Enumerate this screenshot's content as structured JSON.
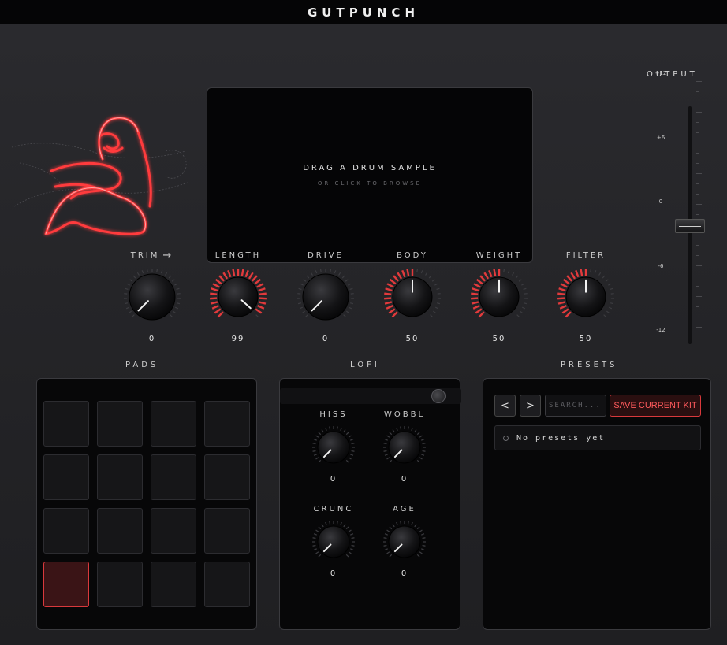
{
  "app": {
    "title": "GUTPUNCH"
  },
  "dropzone": {
    "main": "DRAG A DRUM SAMPLE",
    "sub": "OR CLICK TO BROWSE"
  },
  "knobs": [
    {
      "label": "TRIM",
      "value": "0",
      "arrow": "→",
      "ring": false,
      "level": 0
    },
    {
      "label": "LENGTH",
      "value": "99",
      "ring": true,
      "level": 0.99
    },
    {
      "label": "DRIVE",
      "value": "0",
      "ring": false,
      "level": 0
    },
    {
      "label": "BODY",
      "value": "50",
      "ring": true,
      "level": 0.5
    },
    {
      "label": "WEIGHT",
      "value": "50",
      "ring": true,
      "level": 0.5
    },
    {
      "label": "FILTER",
      "value": "50",
      "ring": true,
      "level": 0.5
    }
  ],
  "output": {
    "label": "OUTPUT",
    "ticks": [
      "+12",
      "+6",
      "0",
      "-6",
      "-12"
    ],
    "level_db": 0
  },
  "sections": {
    "pads": "PADS",
    "lofi": "LOFI",
    "presets": "PRESETS"
  },
  "pads": {
    "count": 16,
    "active_index": 12
  },
  "lofi": {
    "knobs": [
      {
        "label": "HISS",
        "value": "0",
        "level": 0
      },
      {
        "label": "WOBBL",
        "value": "0",
        "level": 0
      },
      {
        "label": "CRUNC",
        "value": "0",
        "level": 0
      },
      {
        "label": "AGE",
        "value": "0",
        "level": 0
      }
    ]
  },
  "presets": {
    "prev_label": "<",
    "next_label": ">",
    "search_placeholder": "SEARCH...",
    "save_label": "SAVE CURRENT KIT",
    "empty_text": "No presets yet"
  },
  "colors": {
    "accent": "#e23a3c",
    "panel": "#070708",
    "background": "#2a2a2e"
  }
}
